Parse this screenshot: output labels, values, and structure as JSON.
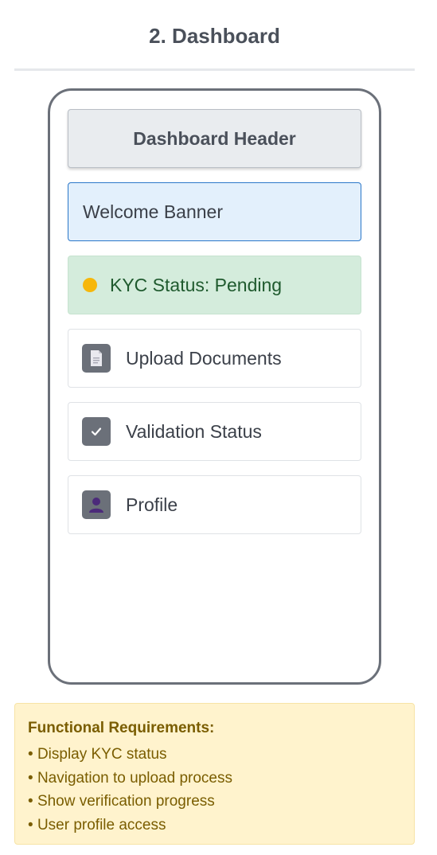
{
  "page": {
    "title": "2. Dashboard"
  },
  "phone": {
    "header_label": "Dashboard Header",
    "welcome_label": "Welcome Banner",
    "kyc_status": {
      "label": "KYC Status: Pending",
      "dot_color": "#f6b70b"
    },
    "nav_items": [
      {
        "label": "Upload Documents",
        "icon": "document-icon"
      },
      {
        "label": "Validation Status",
        "icon": "checkmark-icon"
      },
      {
        "label": "Profile",
        "icon": "user-icon"
      }
    ]
  },
  "requirements": {
    "title": "Functional Requirements:",
    "items": [
      "Display KYC status",
      "Navigation to upload process",
      "Show verification progress",
      "User profile access"
    ]
  },
  "colors": {
    "welcome_border": "#2a77c9",
    "kyc_background": "#d4ecdc",
    "requirements_background": "#fff3cd",
    "requirements_text": "#7a5d00"
  }
}
